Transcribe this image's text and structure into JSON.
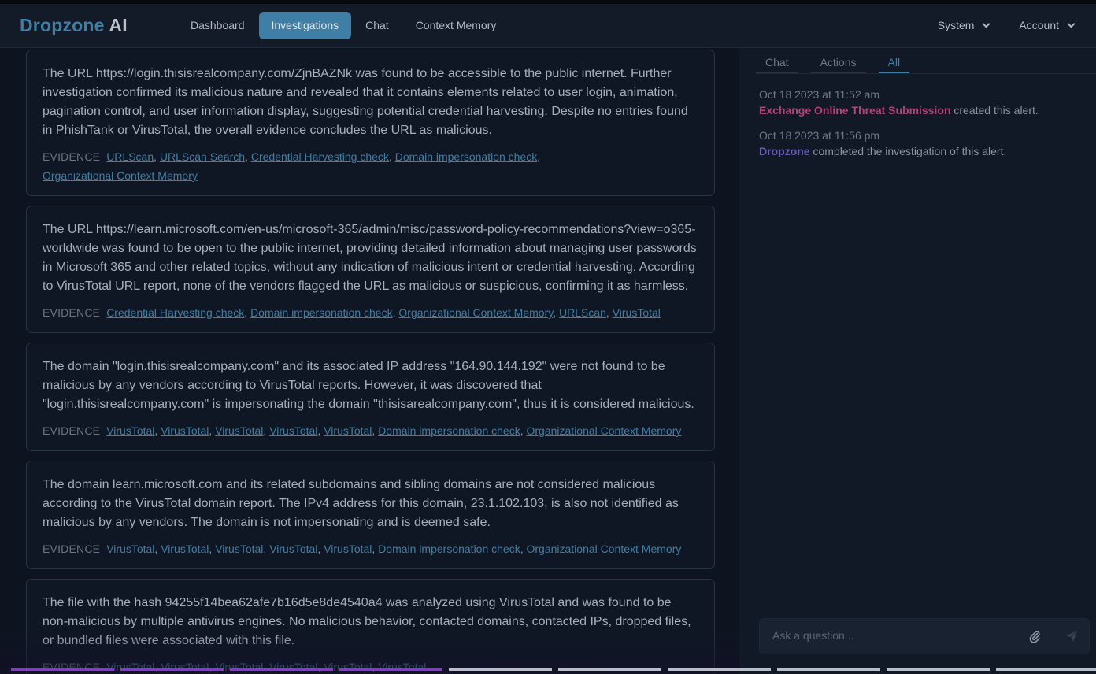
{
  "brand": {
    "part1": "Dropzone",
    "part2": "AI"
  },
  "nav": {
    "links": [
      "Dashboard",
      "Investigations",
      "Chat",
      "Context Memory"
    ],
    "active": "Investigations",
    "system": "System",
    "account": "Account"
  },
  "findings": [
    {
      "text": "The URL https://login.thisisrealcompany.com/ZjnBAZNk was found to be accessible to the public internet. Further investigation confirmed its malicious nature and revealed that it contains elements related to user login, animation, pagination control, and user information display, suggesting potential credential harvesting. Despite no entries found in PhishTank or VirusTotal, the overall evidence concludes the URL as malicious.",
      "evidence_label": "EVIDENCE",
      "evidence": [
        "URLScan",
        "URLScan Search",
        "Credential Harvesting check",
        "Domain impersonation check",
        "Organizational Context Memory"
      ]
    },
    {
      "text": "The URL https://learn.microsoft.com/en-us/microsoft-365/admin/misc/password-policy-recommendations?view=o365-worldwide was found to be open to the public internet, providing detailed information about managing user passwords in Microsoft 365 and other related topics, without any indication of malicious intent or credential harvesting. According to VirusTotal URL report, none of the vendors flagged the URL as malicious or suspicious, confirming it as harmless.",
      "evidence_label": "EVIDENCE",
      "evidence": [
        "Credential Harvesting check",
        "Domain impersonation check",
        "Organizational Context Memory",
        "URLScan",
        "VirusTotal"
      ]
    },
    {
      "text": "The domain \"login.thisisrealcompany.com\" and its associated IP address \"164.90.144.192\" were not found to be malicious by any vendors according to VirusTotal reports. However, it was discovered that \"login.thisisrealcompany.com\" is impersonating the domain \"thisisarealcompany.com\", thus it is considered malicious.",
      "evidence_label": "EVIDENCE",
      "evidence": [
        "VirusTotal",
        "VirusTotal",
        "VirusTotal",
        "VirusTotal",
        "VirusTotal",
        "Domain impersonation check",
        "Organizational Context Memory"
      ]
    },
    {
      "text": "The domain learn.microsoft.com and its related subdomains and sibling domains are not considered malicious according to the VirusTotal domain report. The IPv4 address for this domain, 23.1.102.103, is also not identified as malicious by any vendors. The domain is not impersonating and is deemed safe.",
      "evidence_label": "EVIDENCE",
      "evidence": [
        "VirusTotal",
        "VirusTotal",
        "VirusTotal",
        "VirusTotal",
        "VirusTotal",
        "Domain impersonation check",
        "Organizational Context Memory"
      ]
    },
    {
      "text": "The file with the hash 94255f14bea62afe7b16d5e8de4540a4 was analyzed using VirusTotal and was found to be non-malicious by multiple antivirus engines. No malicious behavior, contacted domains, contacted IPs, dropped files, or bundled files were associated with this file.",
      "evidence_label": "EVIDENCE",
      "evidence": [
        "VirusTotal",
        "VirusTotal",
        "VirusTotal",
        "VirusTotal",
        "VirusTotal",
        "VirusTotal"
      ]
    }
  ],
  "activity": {
    "tabs": [
      "Chat",
      "Actions",
      "All"
    ],
    "active_tab": "All",
    "events": [
      {
        "time": "Oct 18 2023 at 11:52 am",
        "actor": "Exchange Online Threat Submission",
        "action": "created this alert."
      },
      {
        "time": "Oct 18 2023 at 11:56 pm",
        "actor": "Dropzone",
        "action": "completed the investigation of this alert."
      }
    ]
  },
  "ask": {
    "placeholder": "Ask a question..."
  },
  "progress": {
    "total_steps": 10,
    "completed_steps": 4
  },
  "colors": {
    "accent": "#3f7fa6",
    "creator_actor": "#b0457d",
    "dropzone_actor": "#6a5fb0",
    "progress_done": "#8b34d9"
  }
}
